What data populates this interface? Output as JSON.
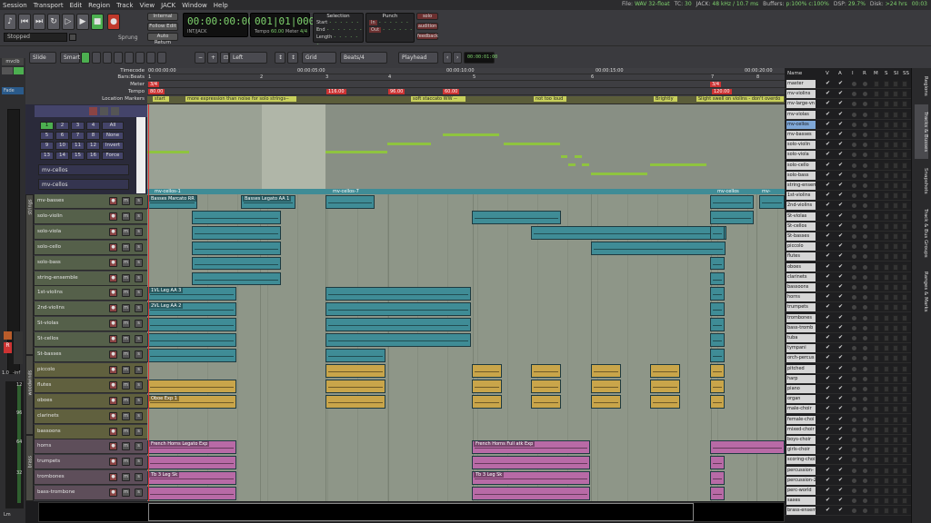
{
  "menu": [
    "Session",
    "Transport",
    "Edit",
    "Region",
    "Track",
    "View",
    "JACK",
    "Window",
    "Help"
  ],
  "status": [
    {
      "label": "File:",
      "value": "WAV 32-float"
    },
    {
      "label": "TC:",
      "value": "30"
    },
    {
      "label": "JACK:",
      "value": "48 kHz / 10.7 ms"
    },
    {
      "label": "Buffers:",
      "value": "p:100% c:100%"
    },
    {
      "label": "DSP:",
      "value": "29.7%"
    },
    {
      "label": "Disk:",
      "value": ">24 hrs"
    },
    {
      "label": "",
      "value": "00:03"
    }
  ],
  "transport": {
    "options": [
      "Internal",
      "Follow Edit",
      "Auto Return"
    ],
    "stopped": "Stopped",
    "shuttle": "Sprung",
    "primary_clock": "00:00:00:00",
    "primary_sub": "INT/JACK",
    "secondary_clock": "001|01|0000",
    "tempo_label": "Tempo",
    "tempo": "60.00",
    "meter_label": "Meter",
    "meter": "4/4",
    "selection_title": "Selection",
    "sel_start": "Start",
    "sel_end": "End",
    "sel_length": "Length",
    "punch_title": "Punch",
    "punch_in": "In",
    "punch_out": "Out",
    "solo": "solo",
    "audition": "audition",
    "feedback": "feedback"
  },
  "editbar": {
    "edit_mode": "Slide",
    "snap_mode": "Smart",
    "nudge_dir": "Left",
    "grid_label": "Grid",
    "grid_type": "Beats/4",
    "edit_point": "Playhead",
    "nudge_clock": "00:00:01:00"
  },
  "rulers": {
    "labels": [
      "Timecode",
      "Bars:Beats",
      "Meter",
      "Tempo",
      "Location Markers"
    ],
    "timecode": [
      "00:00:00:00",
      "00:00:05:00",
      "00:00:10:00",
      "00:00:15:00",
      "00:00:20:00"
    ],
    "bars": [
      "1",
      "2",
      "3",
      "4",
      "5",
      "6",
      "7",
      "8"
    ],
    "meters": [
      "3/4",
      "3/4"
    ],
    "tempos": [
      "80.00",
      "116.00",
      "96.00",
      "60.00",
      "120.00"
    ],
    "locations": [
      "start",
      "more expression than noise for solo strings--",
      "soft staccato WW --",
      "not too loud",
      "Brightly",
      "Slight swell on violins - don't overdo"
    ]
  },
  "midi_pads": [
    "1",
    "2",
    "3",
    "4",
    "All",
    "5",
    "6",
    "7",
    "8",
    "None",
    "9",
    "10",
    "11",
    "12",
    "Invert",
    "13",
    "14",
    "15",
    "16",
    "Force"
  ],
  "midi_tracks": [
    "mv-cellos",
    "mv-cellos"
  ],
  "left_strip": {
    "mode": "Fade",
    "label_top": "mvclb",
    "val": "1.0",
    "val2": "-inf",
    "meter_marks": [
      "12",
      "96",
      "64",
      "32"
    ],
    "bottom": "Lm"
  },
  "groups": [
    "strings",
    "woodwinds",
    "brass"
  ],
  "tracks": [
    "mv-basses",
    "solo-violin",
    "solo-viola",
    "solo-cello",
    "solo-bass",
    "string-ensemble",
    "1st-violins",
    "2nd-violins",
    "St-violas",
    "St-cellos",
    "St-basses",
    "piccolo",
    "flutes",
    "oboes",
    "clarinets",
    "bassoons",
    "horns",
    "trumpets",
    "trombones",
    "bass-trombone"
  ],
  "track_buttons": {
    "rec": "●",
    "mute": "m",
    "solo": "s"
  },
  "region_names": {
    "cellos1": "mv-cellos-1",
    "cellos2": "mv-cellos-7",
    "cellos3": "mv-cellos",
    "cellos4": "mv-",
    "basses1": "Basses Marcato RR",
    "basses2": "Basses Legato AA 1",
    "v1": "1VL Leg AA 3",
    "v2": "2VL Leg AA 2",
    "oboe": "Oboe Exp 1",
    "horn1": "French Horns Legato Exp",
    "horn2": "French Horns Full atk Exp",
    "tb1": "Tb 3 Leg Sk",
    "tb2": "Tb 3 Leg Sk"
  },
  "track_list": {
    "headers": [
      "Name",
      "V",
      "A",
      "I",
      "R",
      "M",
      "S",
      "SI",
      "SS"
    ],
    "rows": [
      "master",
      "mv-violins",
      "mv-large-vn",
      "mv-violas",
      "mv-cellos",
      "mv-basses",
      "solo-violin",
      "solo-viola",
      "solo-cello",
      "solo-bass",
      "string-ensem",
      "1st-violins",
      "2nd-violins",
      "St-violas",
      "St-cellos",
      "St-basses",
      "piccolo",
      "flutes",
      "oboes",
      "clarinets",
      "bassoons",
      "horns",
      "trumpets",
      "trombones",
      "bass-tromb",
      "tuba",
      "tympani",
      "orch-percus",
      "pitched",
      "harp",
      "piano",
      "organ",
      "male-choir",
      "female-choi",
      "mixed-choir",
      "boys-choir",
      "girls-choir",
      "scoring-choi",
      "percussion-",
      "percussion-2",
      "perc-world",
      "saxes",
      "brass-ensem"
    ],
    "selected": "mv-cellos"
  },
  "side_tabs": [
    "Regions",
    "Tracks & Busses",
    "Snapshots",
    "Track & Bus Groups",
    "Ranges & Marks"
  ],
  "colors": {
    "strings": "#3f8c96",
    "woodwinds": "#c9a54a",
    "brass": "#b86aa6",
    "midi": "#8fc43f",
    "playhead": "#dd3333",
    "clock": "#7fd36e"
  }
}
